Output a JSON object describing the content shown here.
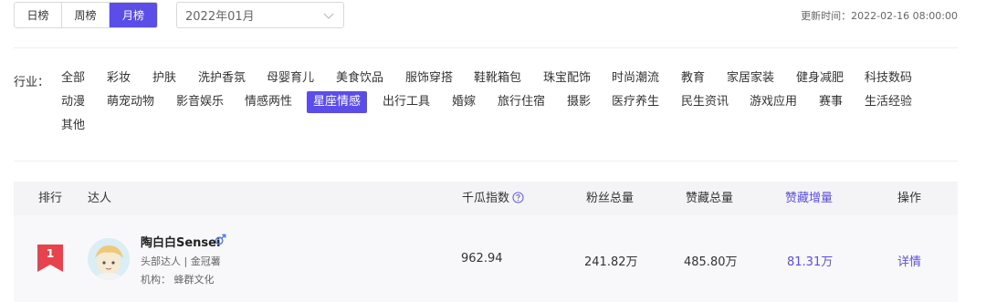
{
  "toolbar": {
    "periods": [
      "日榜",
      "周榜",
      "月榜"
    ],
    "active_period": "月榜",
    "month_value": "2022年01月",
    "update_time": "更新时间：2022-02-16 08:00:00"
  },
  "industry": {
    "label": "行业：",
    "active": "星座情感",
    "tags": [
      "全部",
      "彩妆",
      "护肤",
      "洗护香氛",
      "母婴育儿",
      "美食饮品",
      "服饰穿搭",
      "鞋靴箱包",
      "珠宝配饰",
      "时尚潮流",
      "教育",
      "家居家装",
      "健身减肥",
      "科技数码",
      "动漫",
      "萌宠动物",
      "影音娱乐",
      "情感两性",
      "星座情感",
      "出行工具",
      "婚嫁",
      "旅行住宿",
      "摄影",
      "医疗养生",
      "民生资讯",
      "游戏应用",
      "赛事",
      "生活经验",
      "其他"
    ]
  },
  "table": {
    "headers": {
      "rank": "排行",
      "creator": "达人",
      "index": "千瓜指数",
      "fans": "粉丝总量",
      "likes": "赞藏总量",
      "likes_growth": "赞藏增量",
      "action": "操作"
    },
    "rows": [
      {
        "rank": "1",
        "name": "陶白白Sensei",
        "gender_icon": "male-icon",
        "subtitle": "头部达人 | 金冠薯",
        "org": "机构：  蜂群文化",
        "index": "962.94",
        "fans": "241.82万",
        "likes": "485.80万",
        "likes_growth": "81.31万",
        "action": "详情"
      }
    ]
  },
  "colors": {
    "accent": "#5b4ee8",
    "rank_badge": "#e8424f"
  }
}
